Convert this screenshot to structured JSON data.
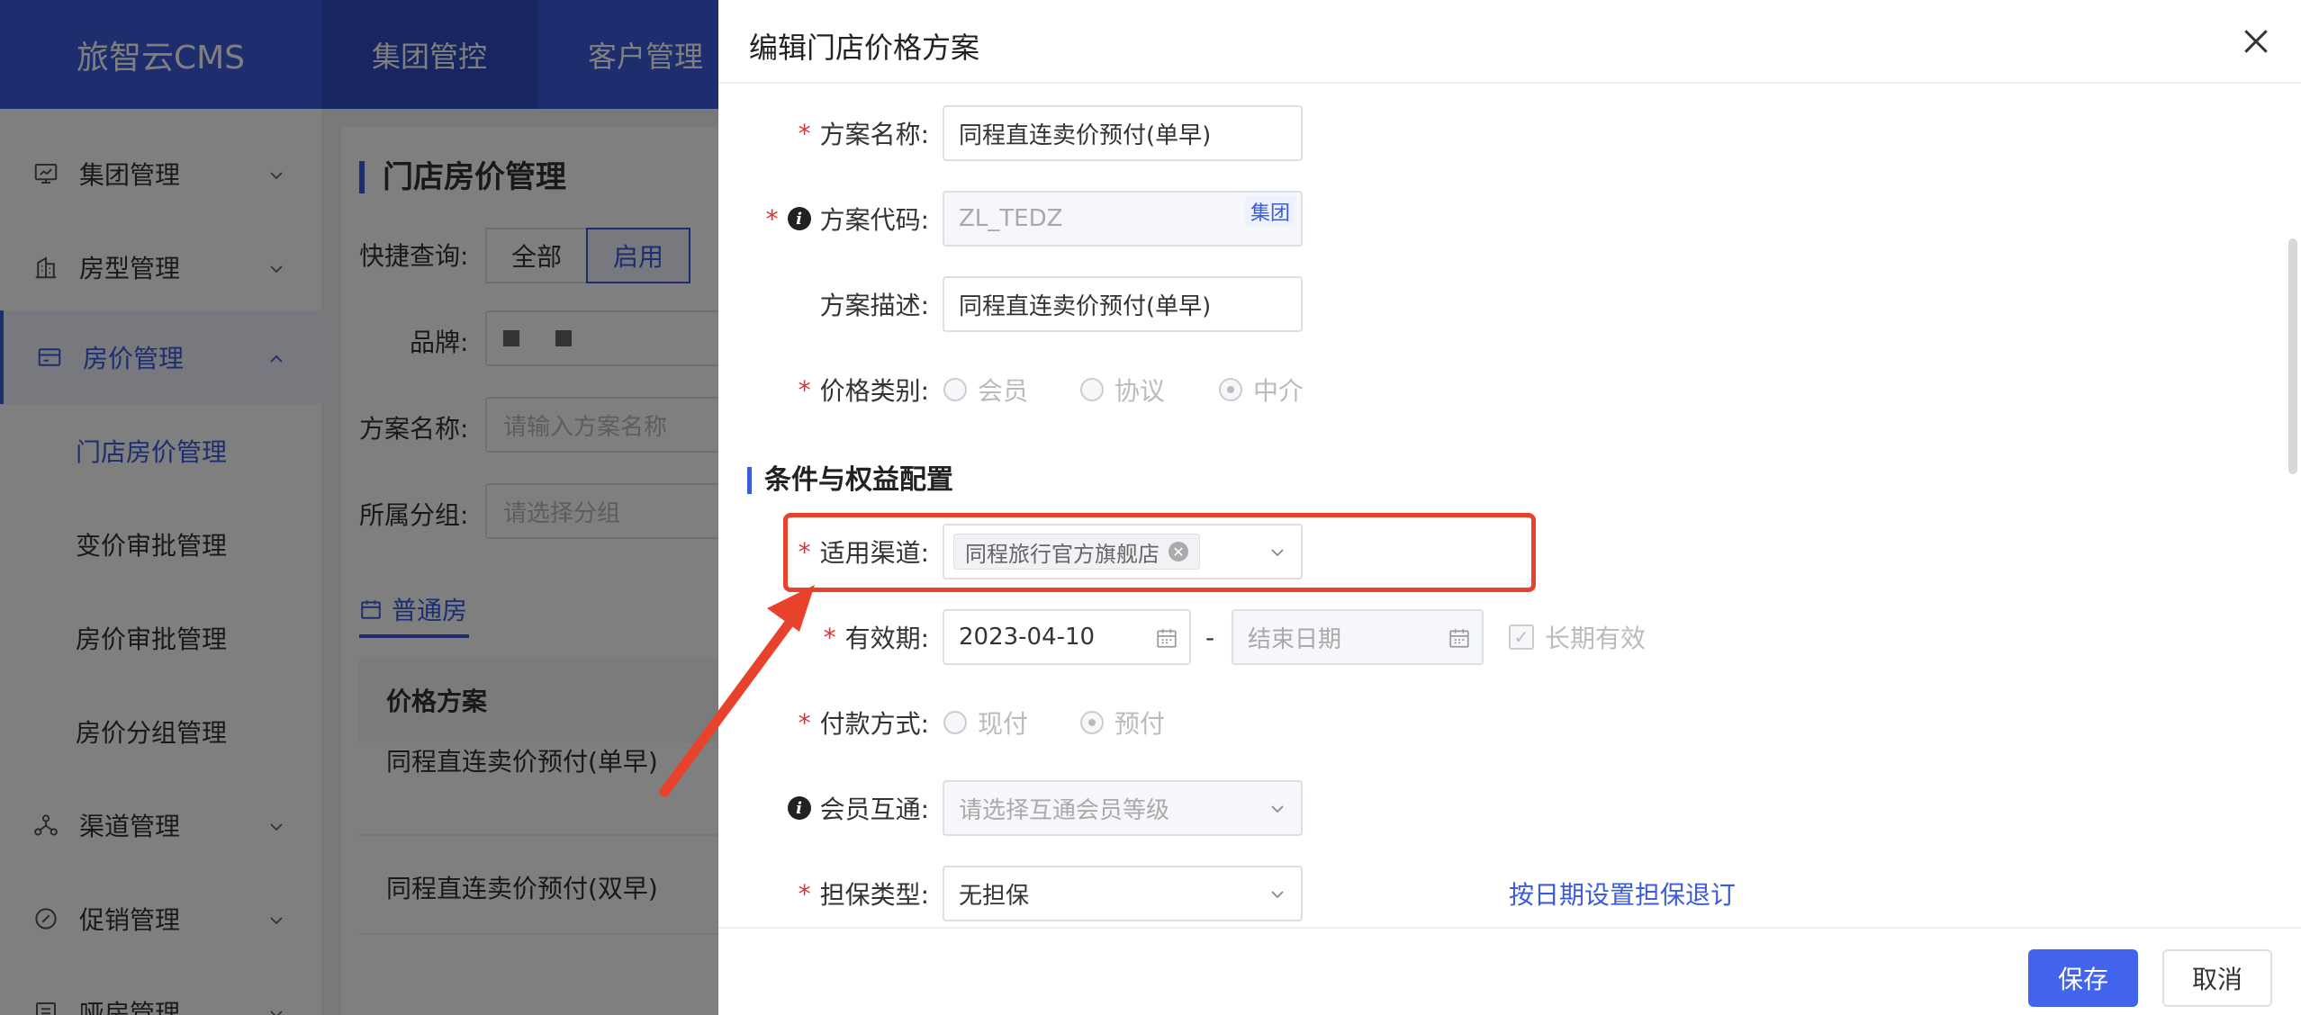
{
  "app": {
    "logo": "旅智云CMS",
    "topnav": [
      "集团管控",
      "客户管理"
    ]
  },
  "sidebar": {
    "items": [
      {
        "label": "集团管理",
        "icon": "monitor-icon"
      },
      {
        "label": "房型管理",
        "icon": "building-icon"
      },
      {
        "label": "房价管理",
        "icon": "card-icon"
      },
      {
        "label": "渠道管理",
        "icon": "network-icon"
      },
      {
        "label": "促销管理",
        "icon": "gear-badge-icon"
      },
      {
        "label": "哑房管理",
        "icon": "list-icon"
      }
    ],
    "subitems": [
      "门店房价管理",
      "变价审批管理",
      "房价审批管理",
      "房价分组管理"
    ]
  },
  "background_page": {
    "title": "门店房价管理",
    "quick_query_label": "快捷查询:",
    "quick_buttons": [
      "全部",
      "启用"
    ],
    "brand_label": "品牌:",
    "plan_name_label": "方案名称:",
    "plan_name_placeholder": "请输入方案名称",
    "group_label": "所属分组:",
    "group_placeholder": "请选择分组",
    "tab": "普通房",
    "table_header": "价格方案",
    "rows": [
      "同程直连卖价预付(单早)",
      "同程直连卖价预付(双早)"
    ]
  },
  "drawer": {
    "title": "编辑门店价格方案",
    "fields": {
      "plan_name": {
        "label": "方案名称:",
        "value": "同程直连卖价预付(单早)"
      },
      "plan_code": {
        "label": "方案代码:",
        "value": "ZL_TEDZ",
        "tag": "集团"
      },
      "plan_desc": {
        "label": "方案描述:",
        "value": "同程直连卖价预付(单早)"
      },
      "price_type": {
        "label": "价格类别:",
        "options": [
          "会员",
          "协议",
          "中介"
        ],
        "selected": "中介"
      }
    },
    "section_title": "条件与权益配置",
    "conditions": {
      "channel": {
        "label": "适用渠道:",
        "chip": "同程旅行官方旗舰店"
      },
      "validity": {
        "label": "有效期:",
        "start": "2023-04-10",
        "separator": "-",
        "end_placeholder": "结束日期",
        "long_term": "长期有效"
      },
      "payment": {
        "label": "付款方式:",
        "options": [
          "现付",
          "预付"
        ],
        "selected": "预付"
      },
      "member": {
        "label": "会员互通:",
        "placeholder": "请选择互通会员等级"
      },
      "guarantee": {
        "label": "担保类型:",
        "value": "无担保",
        "link": "按日期设置担保退订"
      }
    },
    "footer": {
      "save": "保存",
      "cancel": "取消"
    }
  },
  "colors": {
    "primary": "#3b5bdb",
    "required": "#e03131",
    "annotation": "#e8412c"
  }
}
